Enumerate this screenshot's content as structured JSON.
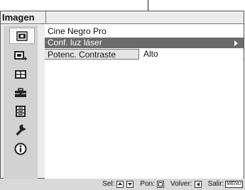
{
  "window": {
    "title": "Imagen"
  },
  "sidebar": {
    "items": [
      {
        "icon": "picture-icon",
        "selected": true
      },
      {
        "icon": "picture-plus-icon",
        "selected": false
      },
      {
        "icon": "screen-setup-icon",
        "selected": false
      },
      {
        "icon": "toolbox-icon",
        "selected": false
      },
      {
        "icon": "list-menu-icon",
        "selected": false
      },
      {
        "icon": "wrench-icon",
        "selected": false
      },
      {
        "icon": "info-icon",
        "selected": false
      }
    ]
  },
  "menu": {
    "header": "Cine Negro Pro",
    "items": [
      {
        "label": "Conf. luz láser",
        "has_submenu": true,
        "selected": true
      },
      {
        "label": "Potenc. Contraste",
        "value": "Alto"
      }
    ]
  },
  "footer": {
    "sel_label": "Sel:",
    "pon_label": "Pon:",
    "volver_label": "Volver:",
    "salir_label": "Salir:",
    "menu_key": "MENU"
  }
}
